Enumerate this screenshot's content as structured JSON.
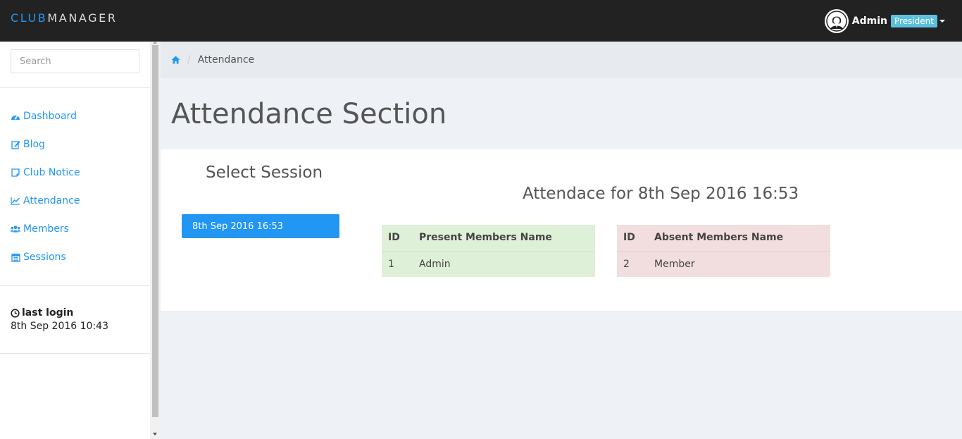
{
  "navbar": {
    "brand_club": "CLUB",
    "brand_manager": "MANAGER",
    "user_name": "Admin",
    "role": "President"
  },
  "sidebar": {
    "search_placeholder": "Search",
    "items": [
      {
        "label": "Dashboard",
        "icon": "dashboard-icon"
      },
      {
        "label": "Blog",
        "icon": "edit-icon"
      },
      {
        "label": "Club Notice",
        "icon": "notice-icon"
      },
      {
        "label": "Attendance",
        "icon": "line-chart-icon"
      },
      {
        "label": "Members",
        "icon": "users-icon"
      },
      {
        "label": "Sessions",
        "icon": "calendar-icon"
      }
    ],
    "last_login_label": "last login",
    "last_login_time": "8th Sep 2016 10:43"
  },
  "breadcrumb": {
    "current": "Attendance"
  },
  "page": {
    "title": "Attendance Section",
    "select_session_title": "Select Session",
    "session_button": "8th Sep 2016 16:53",
    "attendance_title": "Attendace for 8th Sep 2016 16:53"
  },
  "present_table": {
    "headers": [
      "ID",
      "Present Members Name"
    ],
    "rows": [
      [
        "1",
        "Admin"
      ]
    ]
  },
  "absent_table": {
    "headers": [
      "ID",
      "Absent Members Name"
    ],
    "rows": [
      [
        "2",
        "Member"
      ]
    ]
  },
  "colors": {
    "accent": "#2196f3",
    "navbar": "#222222",
    "present_bg": "#dff0d8",
    "absent_bg": "#f2dede",
    "badge": "#5bc0de"
  }
}
